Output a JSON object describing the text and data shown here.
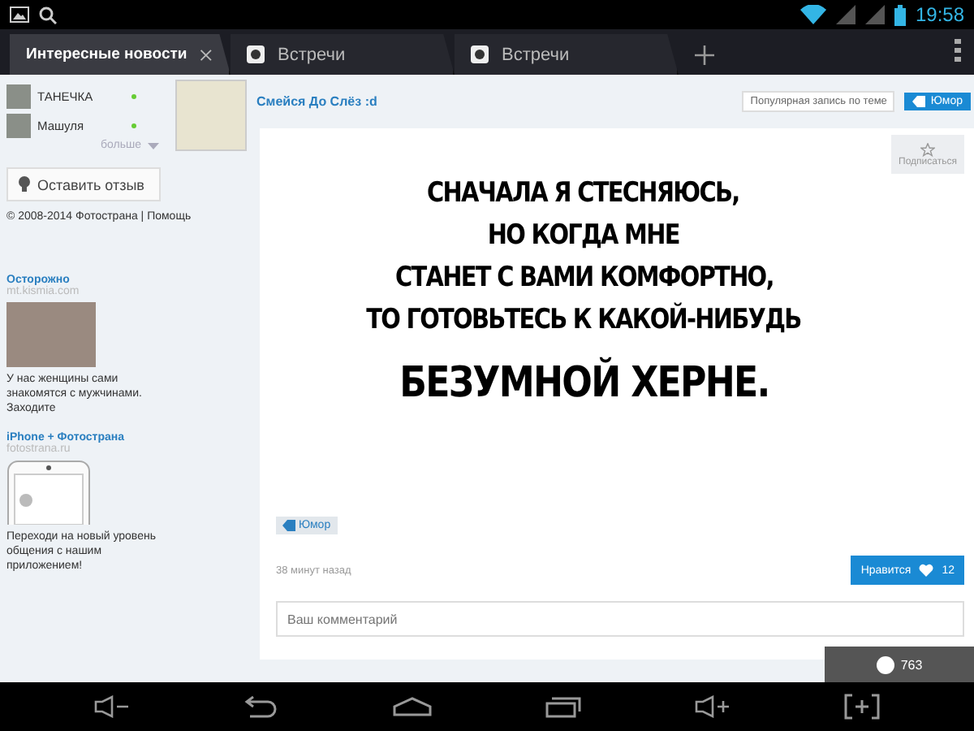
{
  "status_bar": {
    "time": "19:58"
  },
  "tabs": [
    {
      "label": "Интересные новости",
      "selected": true,
      "closable": true
    },
    {
      "label": "Встречи",
      "selected": false,
      "closable": false
    },
    {
      "label": "Встречи",
      "selected": false,
      "closable": false
    }
  ],
  "sidebar": {
    "friends": [
      {
        "name": "ТАНЕЧКА",
        "online": true
      },
      {
        "name": "Машуля",
        "online": true
      }
    ],
    "more": "больше",
    "feedback_button": "Оставить отзыв",
    "footer": "© 2008-2014 Фотострана | Помощь",
    "ads": [
      {
        "title": "Осторожно",
        "domain": "mt.kismia.com",
        "text": "У нас женщины сами знакомятся с мужчинами. Заходите",
        "kind": "photo"
      },
      {
        "title": "iPhone + Фотострана",
        "domain": "fotostrana.ru",
        "text": "Переходи на новый уровень общения с нашим приложением!",
        "kind": "phone"
      }
    ]
  },
  "post": {
    "author": "Смейся До Слёз :d",
    "popular_label": "Популярная запись по теме",
    "topic_tag": "Юмор",
    "subscribe": "Подписаться",
    "meme_lines": [
      "СНАЧАЛА Я СТЕСНЯЮСЬ,",
      "НО КОГДА МНЕ",
      "СТАНЕТ С ВАМИ КОМФОРТНО,",
      "ТО ГОТОВЬТЕСЬ К КАКОЙ-НИБУДЬ",
      "БЕЗУМНОЙ ХЕРНЕ."
    ],
    "tag": "Юмор",
    "time": "38 минут назад",
    "like_label": "Нравится",
    "like_count": "12",
    "comment_placeholder": "Ваш комментарий"
  },
  "messages_badge": {
    "count": "763"
  }
}
